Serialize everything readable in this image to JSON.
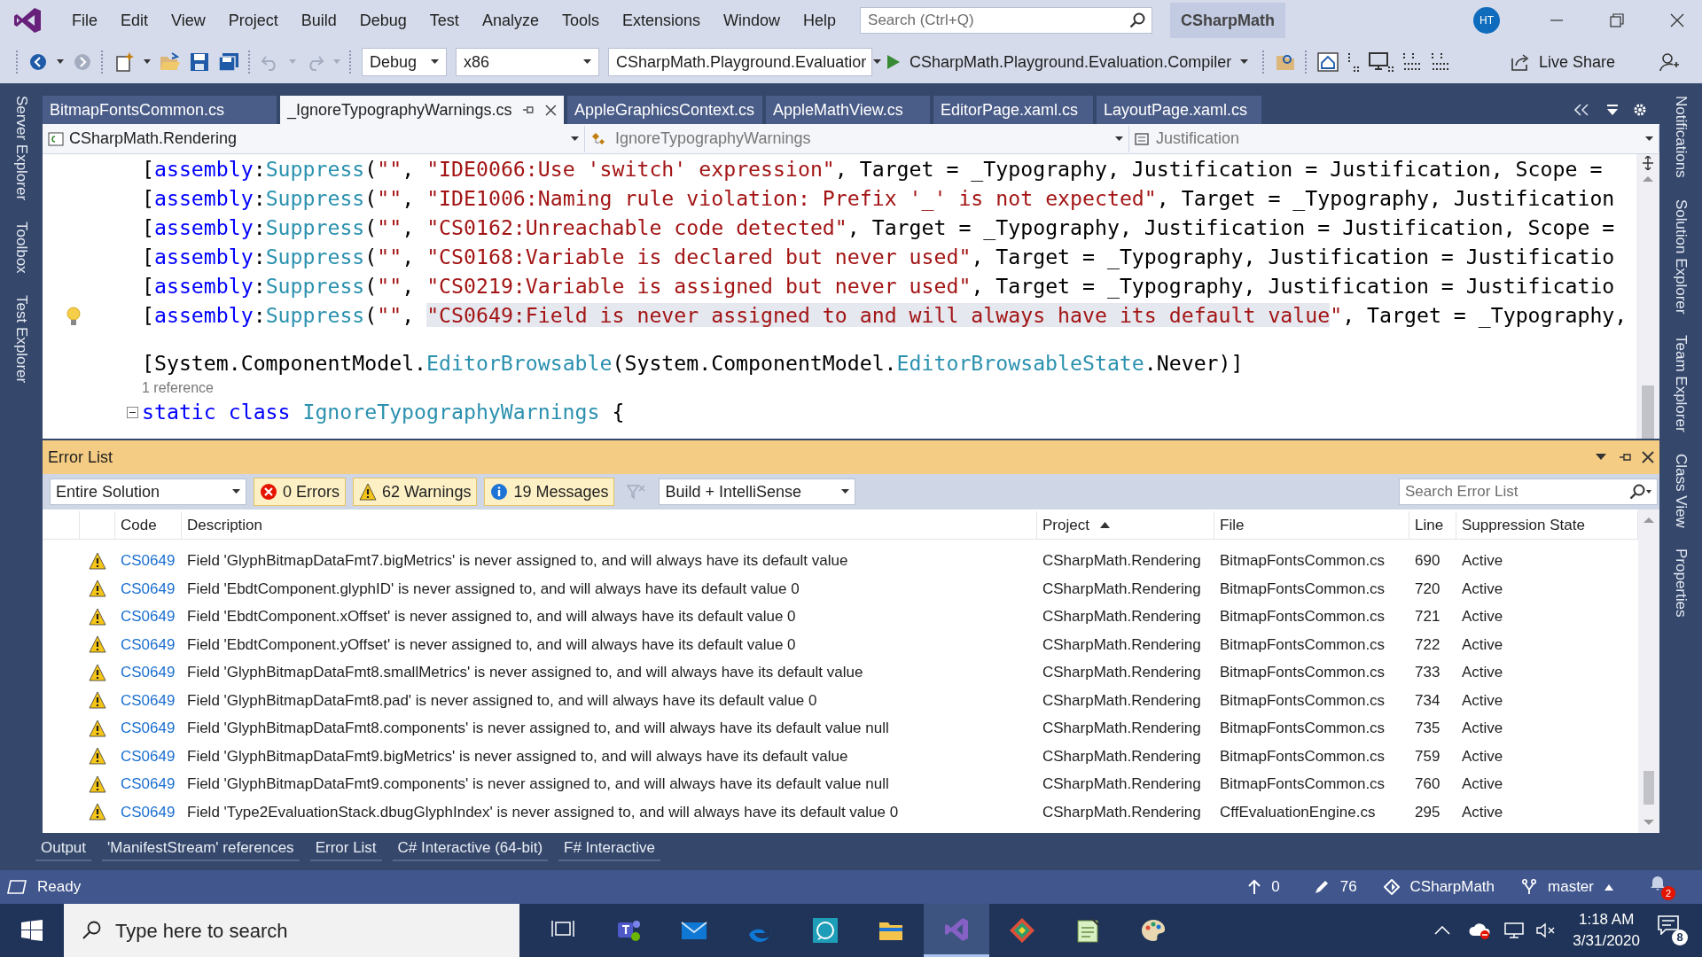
{
  "menu": [
    "File",
    "Edit",
    "View",
    "Project",
    "Build",
    "Debug",
    "Test",
    "Analyze",
    "Tools",
    "Extensions",
    "Window",
    "Help"
  ],
  "search": {
    "placeholder": "Search (Ctrl+Q)"
  },
  "solution_name": "CSharpMath",
  "user_initials": "HT",
  "toolbar": {
    "configuration": "Debug",
    "platform": "x86",
    "startup_project": "CSharpMath.Playground.Evaluatior",
    "run_target": "CSharpMath.Playground.Evaluation.Compiler",
    "live_share": "Live Share"
  },
  "left_tool_windows": [
    "Server Explorer",
    "Toolbox",
    "Test Explorer"
  ],
  "right_tool_windows": [
    "Notifications",
    "Solution Explorer",
    "Team Explorer",
    "Class View",
    "Properties"
  ],
  "document_tabs": [
    {
      "label": "BitmapFontsCommon.cs",
      "selected": false
    },
    {
      "label": "_IgnoreTypographyWarnings.cs",
      "selected": true
    },
    {
      "label": "AppleGraphicsContext.cs",
      "selected": false
    },
    {
      "label": "AppleMathView.cs",
      "selected": false
    },
    {
      "label": "EditorPage.xaml.cs",
      "selected": false
    },
    {
      "label": "LayoutPage.xaml.cs",
      "selected": false
    }
  ],
  "navigation_bar": {
    "project": "CSharpMath.Rendering",
    "type": "IgnoreTypographyWarnings",
    "member": "Justification"
  },
  "code_lines": [
    {
      "kind": "code",
      "lightbulb": false,
      "collapsible": false,
      "tokens": [
        {
          "kind": "p",
          "text": "["
        },
        {
          "kind": "kw",
          "text": "assembly"
        },
        {
          "kind": "p",
          "text": ":"
        },
        {
          "kind": "type",
          "text": "Suppress"
        },
        {
          "kind": "p",
          "text": "("
        },
        {
          "kind": "str",
          "text": "\"\""
        },
        {
          "kind": "p",
          "text": ", "
        },
        {
          "kind": "str",
          "text": "\"IDE0066:Use 'switch' expression\""
        },
        {
          "kind": "p",
          "text": ", Target = _Typography, Justification = Justification, Scope ="
        }
      ]
    },
    {
      "kind": "code",
      "lightbulb": false,
      "collapsible": false,
      "tokens": [
        {
          "kind": "p",
          "text": "["
        },
        {
          "kind": "kw",
          "text": "assembly"
        },
        {
          "kind": "p",
          "text": ":"
        },
        {
          "kind": "type",
          "text": "Suppress"
        },
        {
          "kind": "p",
          "text": "("
        },
        {
          "kind": "str",
          "text": "\"\""
        },
        {
          "kind": "p",
          "text": ", "
        },
        {
          "kind": "str",
          "text": "\"IDE1006:Naming rule violation: Prefix '_' is not expected\""
        },
        {
          "kind": "p",
          "text": ", Target = _Typography, Justification"
        }
      ]
    },
    {
      "kind": "code",
      "lightbulb": false,
      "collapsible": false,
      "tokens": [
        {
          "kind": "p",
          "text": "["
        },
        {
          "kind": "kw",
          "text": "assembly"
        },
        {
          "kind": "p",
          "text": ":"
        },
        {
          "kind": "type",
          "text": "Suppress"
        },
        {
          "kind": "p",
          "text": "("
        },
        {
          "kind": "str",
          "text": "\"\""
        },
        {
          "kind": "p",
          "text": ", "
        },
        {
          "kind": "str",
          "text": "\"CS0162:Unreachable code detected\""
        },
        {
          "kind": "p",
          "text": ", Target = _Typography, Justification = Justification, Scope ="
        }
      ]
    },
    {
      "kind": "code",
      "lightbulb": false,
      "collapsible": false,
      "tokens": [
        {
          "kind": "p",
          "text": "["
        },
        {
          "kind": "kw",
          "text": "assembly"
        },
        {
          "kind": "p",
          "text": ":"
        },
        {
          "kind": "type",
          "text": "Suppress"
        },
        {
          "kind": "p",
          "text": "("
        },
        {
          "kind": "str",
          "text": "\"\""
        },
        {
          "kind": "p",
          "text": ", "
        },
        {
          "kind": "str",
          "text": "\"CS0168:Variable is declared but never used\""
        },
        {
          "kind": "p",
          "text": ", Target = _Typography, Justification = Justificatio"
        }
      ]
    },
    {
      "kind": "code",
      "lightbulb": false,
      "collapsible": false,
      "tokens": [
        {
          "kind": "p",
          "text": "["
        },
        {
          "kind": "kw",
          "text": "assembly"
        },
        {
          "kind": "p",
          "text": ":"
        },
        {
          "kind": "type",
          "text": "Suppress"
        },
        {
          "kind": "p",
          "text": "("
        },
        {
          "kind": "str",
          "text": "\"\""
        },
        {
          "kind": "p",
          "text": ", "
        },
        {
          "kind": "str",
          "text": "\"CS0219:Variable is assigned but never used\""
        },
        {
          "kind": "p",
          "text": ", Target = _Typography, Justification = Justificatio"
        }
      ]
    },
    {
      "kind": "code",
      "lightbulb": true,
      "collapsible": false,
      "tokens": [
        {
          "kind": "p",
          "text": "["
        },
        {
          "kind": "kw",
          "text": "assembly"
        },
        {
          "kind": "p",
          "text": ":"
        },
        {
          "kind": "type",
          "text": "Suppress"
        },
        {
          "kind": "p",
          "text": "("
        },
        {
          "kind": "str",
          "text": "\"\""
        },
        {
          "kind": "p",
          "text": ", "
        },
        {
          "kind": "strsel",
          "text": "\"CS0649:Field is never assigned to and will always have its default value"
        },
        {
          "kind": "str",
          "text": "\""
        },
        {
          "kind": "p",
          "text": ", Target = _Typography,"
        }
      ]
    },
    {
      "kind": "blank",
      "lightbulb": false,
      "collapsible": false
    },
    {
      "kind": "code",
      "lightbulb": false,
      "collapsible": false,
      "tokens": [
        {
          "kind": "p",
          "text": "[System.ComponentModel."
        },
        {
          "kind": "type",
          "text": "EditorBrowsable"
        },
        {
          "kind": "p",
          "text": "(System.ComponentModel."
        },
        {
          "kind": "type",
          "text": "EditorBrowsableState"
        },
        {
          "kind": "p",
          "text": ".Never)]"
        }
      ]
    },
    {
      "kind": "codelens",
      "lightbulb": false,
      "collapsible": false,
      "text": "1 reference"
    },
    {
      "kind": "code",
      "lightbulb": false,
      "collapsible": true,
      "tokens": [
        {
          "kind": "kw",
          "text": "static class"
        },
        {
          "kind": "type",
          "text": "IgnoreTypographyWarnings"
        },
        {
          "kind": "p",
          "text": "{"
        }
      ]
    }
  ],
  "error_list": {
    "title": "Error List",
    "scope": "Entire Solution",
    "filters": [
      {
        "kind": "error",
        "label": "0 Errors",
        "selected": true
      },
      {
        "kind": "warning",
        "label": "62 Warnings",
        "selected": true
      },
      {
        "kind": "message",
        "label": "19 Messages",
        "selected": true
      }
    ],
    "source": "Build + IntelliSense",
    "search_placeholder": "Search Error List",
    "columns": [
      {
        "label": "Code",
        "sorted": false
      },
      {
        "label": "Description",
        "sorted": false
      },
      {
        "label": "Project",
        "sorted": true
      },
      {
        "label": "File",
        "sorted": false
      },
      {
        "label": "Line",
        "sorted": false
      },
      {
        "label": "Suppression State",
        "sorted": false
      }
    ],
    "rows": [
      {
        "kind": "warning",
        "code": "CS0649",
        "description": "Field 'GlyphBitmapDataFmt7.bigMetrics' is never assigned to, and will always have its default value",
        "project": "CSharpMath.Rendering",
        "file": "BitmapFontsCommon.cs",
        "line": "690",
        "suppression_state": "Active"
      },
      {
        "kind": "warning",
        "code": "CS0649",
        "description": "Field 'EbdtComponent.glyphID' is never assigned to, and will always have its default value 0",
        "project": "CSharpMath.Rendering",
        "file": "BitmapFontsCommon.cs",
        "line": "720",
        "suppression_state": "Active"
      },
      {
        "kind": "warning",
        "code": "CS0649",
        "description": "Field 'EbdtComponent.xOffset' is never assigned to, and will always have its default value 0",
        "project": "CSharpMath.Rendering",
        "file": "BitmapFontsCommon.cs",
        "line": "721",
        "suppression_state": "Active"
      },
      {
        "kind": "warning",
        "code": "CS0649",
        "description": "Field 'EbdtComponent.yOffset' is never assigned to, and will always have its default value 0",
        "project": "CSharpMath.Rendering",
        "file": "BitmapFontsCommon.cs",
        "line": "722",
        "suppression_state": "Active"
      },
      {
        "kind": "warning",
        "code": "CS0649",
        "description": "Field 'GlyphBitmapDataFmt8.smallMetrics' is never assigned to, and will always have its default value",
        "project": "CSharpMath.Rendering",
        "file": "BitmapFontsCommon.cs",
        "line": "733",
        "suppression_state": "Active"
      },
      {
        "kind": "warning",
        "code": "CS0649",
        "description": "Field 'GlyphBitmapDataFmt8.pad' is never assigned to, and will always have its default value 0",
        "project": "CSharpMath.Rendering",
        "file": "BitmapFontsCommon.cs",
        "line": "734",
        "suppression_state": "Active"
      },
      {
        "kind": "warning",
        "code": "CS0649",
        "description": "Field 'GlyphBitmapDataFmt8.components' is never assigned to, and will always have its default value null",
        "project": "CSharpMath.Rendering",
        "file": "BitmapFontsCommon.cs",
        "line": "735",
        "suppression_state": "Active"
      },
      {
        "kind": "warning",
        "code": "CS0649",
        "description": "Field 'GlyphBitmapDataFmt9.bigMetrics' is never assigned to, and will always have its default value",
        "project": "CSharpMath.Rendering",
        "file": "BitmapFontsCommon.cs",
        "line": "759",
        "suppression_state": "Active"
      },
      {
        "kind": "warning",
        "code": "CS0649",
        "description": "Field 'GlyphBitmapDataFmt9.components' is never assigned to, and will always have its default value null",
        "project": "CSharpMath.Rendering",
        "file": "BitmapFontsCommon.cs",
        "line": "760",
        "suppression_state": "Active"
      },
      {
        "kind": "warning",
        "code": "CS0649",
        "description": "Field 'Type2EvaluationStack.dbugGlyphIndex' is never assigned to, and will always have its default value 0",
        "project": "CSharpMath.Rendering",
        "file": "CffEvaluationEngine.cs",
        "line": "295",
        "suppression_state": "Active"
      }
    ]
  },
  "tool_tabs": [
    "Output",
    "'ManifestStream' references",
    "Error List",
    "C# Interactive (64-bit)",
    "F# Interactive"
  ],
  "status_bar": {
    "text": "Ready",
    "push_count": "0",
    "edits_count": "76",
    "repository": "CSharpMath",
    "branch": "master",
    "notifications": "2"
  },
  "taskbar": {
    "search_placeholder": "Type here to search",
    "apps": [
      {
        "kind": "task-view",
        "selected": false
      },
      {
        "kind": "teams",
        "selected": false
      },
      {
        "kind": "mail",
        "selected": false
      },
      {
        "kind": "edge",
        "selected": false
      },
      {
        "kind": "whatsapp",
        "selected": false
      },
      {
        "kind": "explorer",
        "selected": false
      },
      {
        "kind": "visual-studio",
        "selected": true
      },
      {
        "kind": "git",
        "selected": false
      },
      {
        "kind": "notepad",
        "selected": false
      },
      {
        "kind": "paint",
        "selected": false
      }
    ],
    "time": "1:18 AM",
    "date": "3/31/2020",
    "notification_count": "8"
  }
}
